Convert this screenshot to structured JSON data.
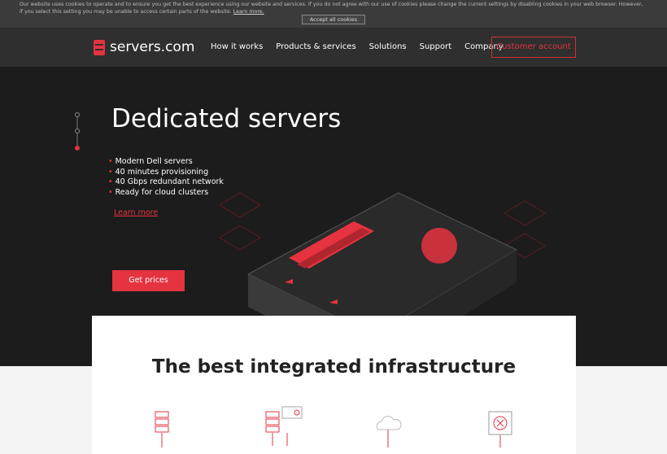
{
  "cookie": {
    "text": "Our website uses cookies to operate and to ensure you get the best experience using our website and services. If you do not agree with our use of cookies please change the current settings by disabling cookies in your web browser. However, if you select this setting you may be unable to access certain parts of the website.",
    "learn_more": "Learn more.",
    "accept": "Accept all cookies"
  },
  "nav": {
    "logo": "servers.com",
    "items": [
      "How it works",
      "Products & services",
      "Solutions",
      "Support",
      "Company"
    ],
    "account": "Customer account"
  },
  "hero": {
    "title": "Dedicated servers",
    "bullets": [
      "Modern Dell servers",
      "40 minutes provisioning",
      "40 Gbps redundant network",
      "Ready for cloud clusters"
    ],
    "learn_more": "Learn more",
    "cta": "Get prices"
  },
  "section": {
    "title": "The best integrated infrastructure",
    "icons": [
      "server-rack-icon",
      "server-config-icon",
      "cloud-icon",
      "chip-icon"
    ]
  },
  "colors": {
    "accent": "#e5333f",
    "dark": "#1c1c1c",
    "nav": "#2f2f2f"
  }
}
